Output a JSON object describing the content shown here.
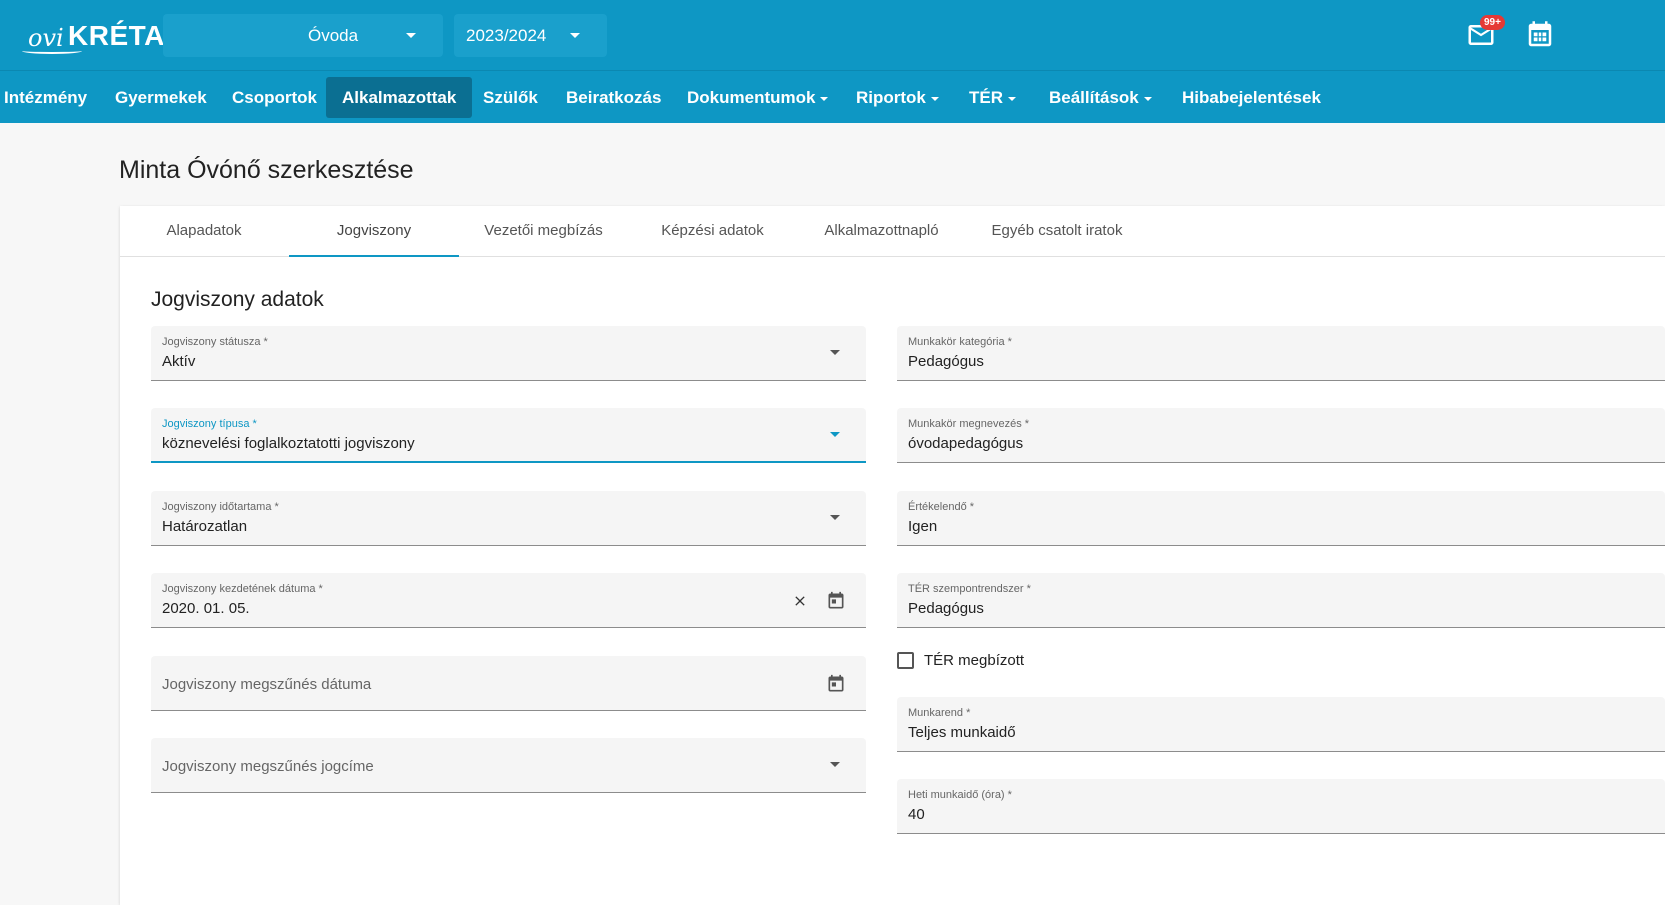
{
  "header": {
    "logo_ovi": "ovi",
    "logo_kreta": "KRÉTA",
    "institution_selector": "Óvoda",
    "year_selector": "2023/2024",
    "mail_badge": "99+",
    "icons": [
      "mail-icon",
      "calendar-icon"
    ]
  },
  "nav": {
    "items": [
      {
        "label": "Intézmény",
        "dropdown": false
      },
      {
        "label": "Gyermekek",
        "dropdown": false
      },
      {
        "label": "Csoportok",
        "dropdown": false
      },
      {
        "label": "Alkalmazottak",
        "dropdown": false,
        "active": true
      },
      {
        "label": "Szülők",
        "dropdown": false
      },
      {
        "label": "Beiratkozás",
        "dropdown": false
      },
      {
        "label": "Dokumentumok",
        "dropdown": true
      },
      {
        "label": "Riportok",
        "dropdown": true
      },
      {
        "label": "TÉR",
        "dropdown": true
      },
      {
        "label": "Beállítások",
        "dropdown": true
      },
      {
        "label": "Hibabejelentések",
        "dropdown": false
      }
    ]
  },
  "page": {
    "title": "Minta Óvónő szerkesztése"
  },
  "tabs": [
    {
      "label": "Alapadatok"
    },
    {
      "label": "Jogviszony",
      "active": true
    },
    {
      "label": "Vezetői megbízás"
    },
    {
      "label": "Képzési adatok"
    },
    {
      "label": "Alkalmazottnapló"
    },
    {
      "label": "Egyéb csatolt iratok"
    }
  ],
  "section": {
    "title": "Jogviszony adatok"
  },
  "left_fields": {
    "status": {
      "label": "Jogviszony státusza *",
      "value": "Aktív"
    },
    "type": {
      "label": "Jogviszony típusa *",
      "value": "köznevelési foglalkoztatotti jogviszony"
    },
    "duration": {
      "label": "Jogviszony időtartama *",
      "value": "Határozatlan"
    },
    "start_date": {
      "label": "Jogviszony kezdetének dátuma *",
      "value": "2020. 01. 05."
    },
    "end_date": {
      "placeholder": "Jogviszony megszűnés dátuma"
    },
    "end_reason": {
      "placeholder": "Jogviszony megszűnés jogcíme"
    }
  },
  "right_fields": {
    "job_category": {
      "label": "Munkakör kategória *",
      "value": "Pedagógus"
    },
    "job_title": {
      "label": "Munkakör megnevezés *",
      "value": "óvodapedagógus"
    },
    "evaluable": {
      "label": "Értékelendő *",
      "value": "Igen"
    },
    "ter_system": {
      "label": "TÉR szempontrendszer *",
      "value": "Pedagógus"
    },
    "ter_delegated": {
      "label": "TÉR megbízott",
      "checked": false
    },
    "work_schedule": {
      "label": "Munkarend *",
      "value": "Teljes munkaidő"
    },
    "weekly_hours": {
      "label": "Heti munkaidő (óra) *",
      "value": "40"
    }
  },
  "colors": {
    "primary": "#0e97c4",
    "nav_active": "#0b6f92",
    "badge": "#e53935"
  }
}
